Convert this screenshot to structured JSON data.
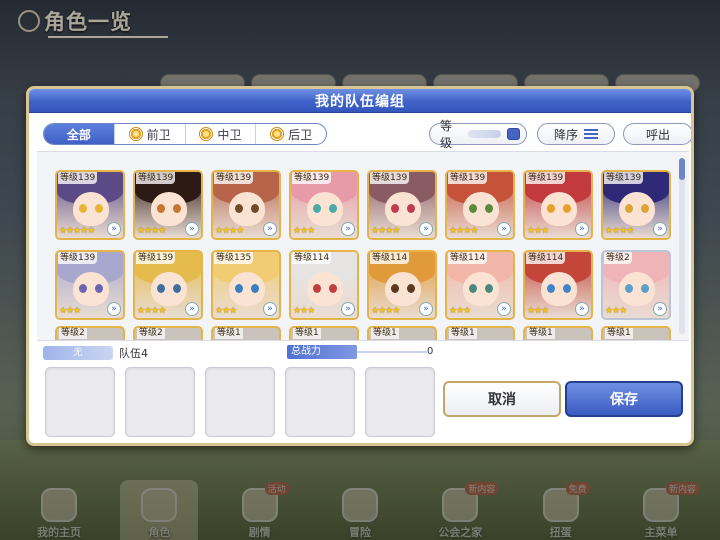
{
  "screen": {
    "title": "角色一览"
  },
  "dialog": {
    "title": "我的队伍编组",
    "filters": [
      {
        "label": "全部",
        "active": true,
        "icon": ""
      },
      {
        "label": "前卫",
        "active": false,
        "icon": "position-icon"
      },
      {
        "label": "中卫",
        "active": false,
        "icon": "position-icon"
      },
      {
        "label": "后卫",
        "active": false,
        "icon": "position-icon"
      }
    ],
    "sort_level_label": "等级",
    "sort_order_label": "降序",
    "call_label": "呼出",
    "characters": [
      {
        "level": "等级139",
        "stars": "★★★★★",
        "hair": "#5b4a86",
        "eyes": "#e7b43a"
      },
      {
        "level": "等级139",
        "stars": "★★★★",
        "hair": "#2d1a14",
        "eyes": "#c8762d"
      },
      {
        "level": "等级139",
        "stars": "★★★★",
        "hair": "#b7644a",
        "eyes": "#6f4b2a"
      },
      {
        "level": "等级139",
        "stars": "★★★",
        "hair": "#e79aa8",
        "eyes": "#4ea8a6"
      },
      {
        "level": "等级139",
        "stars": "★★★★",
        "hair": "#8a5b62",
        "eyes": "#c23a4d"
      },
      {
        "level": "等级139",
        "stars": "★★★★",
        "hair": "#c7523a",
        "eyes": "#5a8a3d"
      },
      {
        "level": "等级139",
        "stars": "★★★",
        "hair": "#c23a3e",
        "eyes": "#e8a128"
      },
      {
        "level": "等级139",
        "stars": "★★★★",
        "hair": "#2e2a78",
        "eyes": "#d9a736"
      },
      {
        "level": "等级139",
        "stars": "★★★",
        "hair": "#a8a8cf",
        "eyes": "#6c64b0"
      },
      {
        "level": "等级139",
        "stars": "★★★★",
        "hair": "#e5bb4d",
        "eyes": "#3f6f9e"
      },
      {
        "level": "等级135",
        "stars": "★★★",
        "hair": "#f1cc72",
        "eyes": "#3a7fc1"
      },
      {
        "level": "等级114",
        "stars": "★★★",
        "hair": "#e6e4e2",
        "eyes": "#c23e3e"
      },
      {
        "level": "等级114",
        "stars": "★★★★",
        "hair": "#e09a3a",
        "eyes": "#5a3a20"
      },
      {
        "level": "等级114",
        "stars": "★★★",
        "hair": "#f2b7a8",
        "eyes": "#4a8a7e"
      },
      {
        "level": "等级114",
        "stars": "★★★",
        "hair": "#c4463a",
        "eyes": "#3f86c9"
      },
      {
        "level": "等级2",
        "stars": "★★★",
        "hair": "#f0b4b8",
        "eyes": "#5aa0c8"
      }
    ],
    "partial_row": [
      "等级2",
      "等级2",
      "等级1",
      "等级1",
      "等级1",
      "等级1",
      "等级1",
      "等级1"
    ],
    "team": {
      "badge": "无",
      "name": "队伍4",
      "power_label": "总战力",
      "power_value": "0"
    },
    "cancel_label": "取消",
    "save_label": "保存"
  },
  "bottom_nav": [
    {
      "label": "我的主页",
      "badge": ""
    },
    {
      "label": "角色",
      "badge": ""
    },
    {
      "label": "剧情",
      "badge": "活动"
    },
    {
      "label": "冒险",
      "badge": ""
    },
    {
      "label": "公会之家",
      "badge": "新内容"
    },
    {
      "label": "扭蛋",
      "badge": "免费"
    },
    {
      "label": "主菜单",
      "badge": "新内容"
    }
  ],
  "colors": {
    "accent": "#3f62c9",
    "frame_gold": "#e4b44a"
  }
}
